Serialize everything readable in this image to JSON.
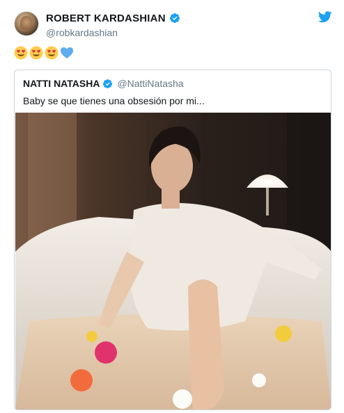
{
  "tweet": {
    "author_name": "ROBERT KARDASHIAN",
    "author_handle": "@robkardashian",
    "emojis": [
      "heart-eyes-emoji",
      "heart-eyes-emoji",
      "heart-eyes-emoji",
      "blue-heart-emoji"
    ]
  },
  "quoted_tweet": {
    "author_name": "NATTI NATASHA",
    "author_handle": "@NattiNatasha",
    "text": "Baby se que tienes una obsesión por mi...",
    "media_description_icon": "photo"
  },
  "colors": {
    "verified_blue": "#1da1f2",
    "twitter_blue": "#1da1f2",
    "handle_gray": "#657786",
    "border_gray": "#ccd6dd"
  }
}
